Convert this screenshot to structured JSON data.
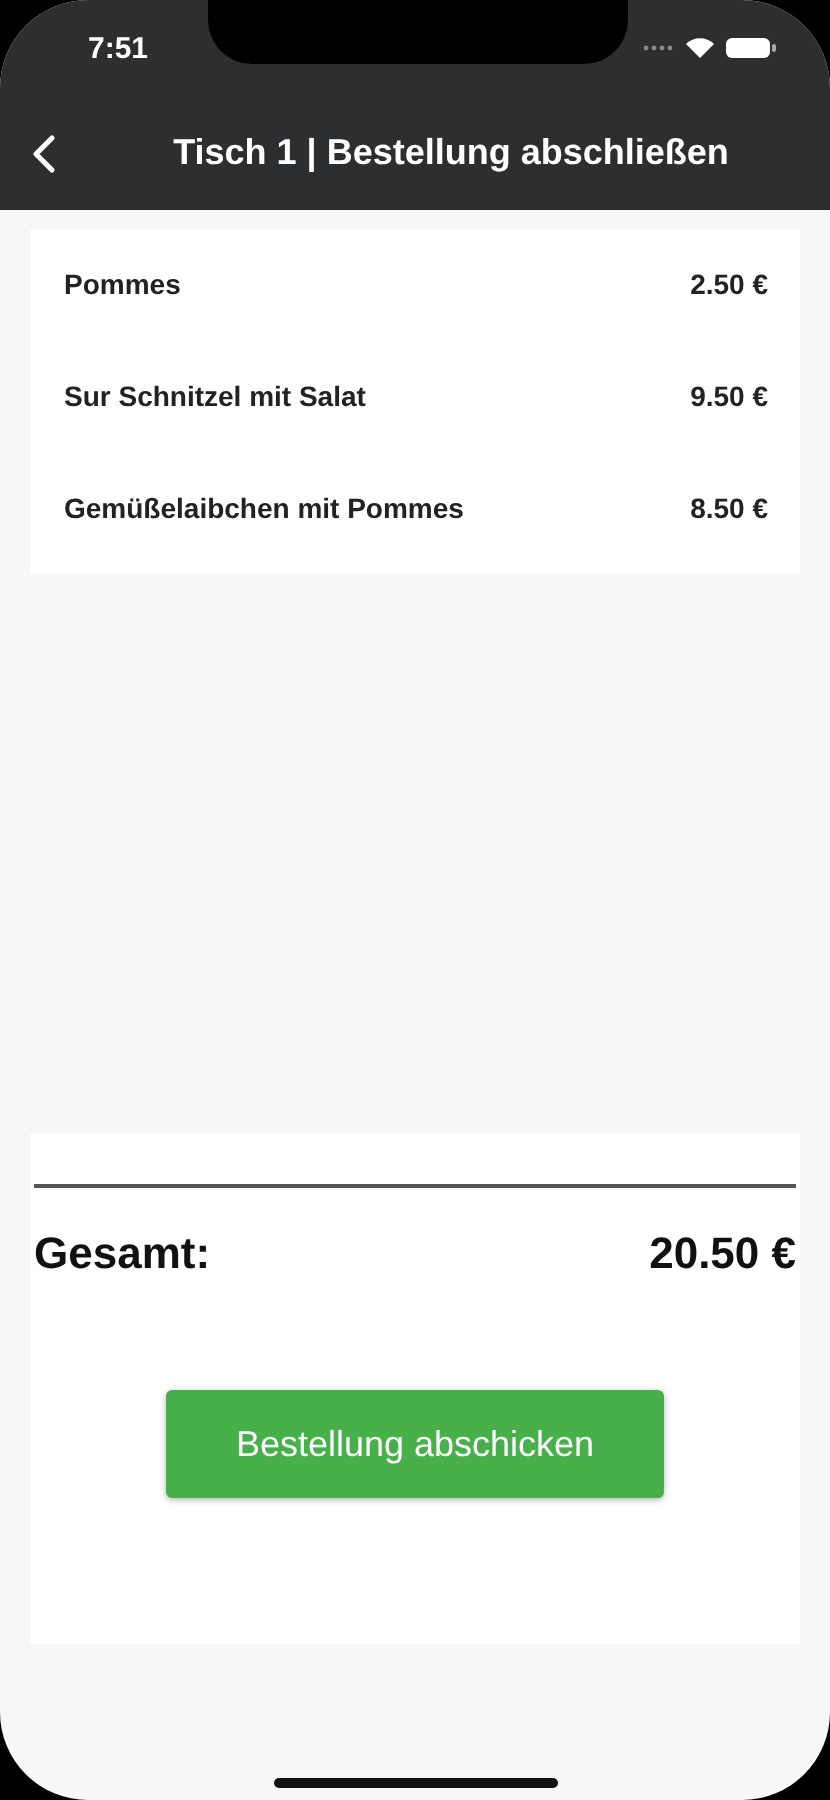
{
  "status_bar": {
    "time": "7:51"
  },
  "header": {
    "title": "Tisch 1 | Bestellung abschließen"
  },
  "items": [
    {
      "name": "Pommes",
      "price": "2.50 €"
    },
    {
      "name": "Sur Schnitzel mit Salat",
      "price": "9.50 €"
    },
    {
      "name": "Gemüßelaibchen mit Pommes",
      "price": "8.50 €"
    }
  ],
  "summary": {
    "label": "Gesamt:",
    "total": "20.50 €",
    "button": "Bestellung abschicken"
  }
}
